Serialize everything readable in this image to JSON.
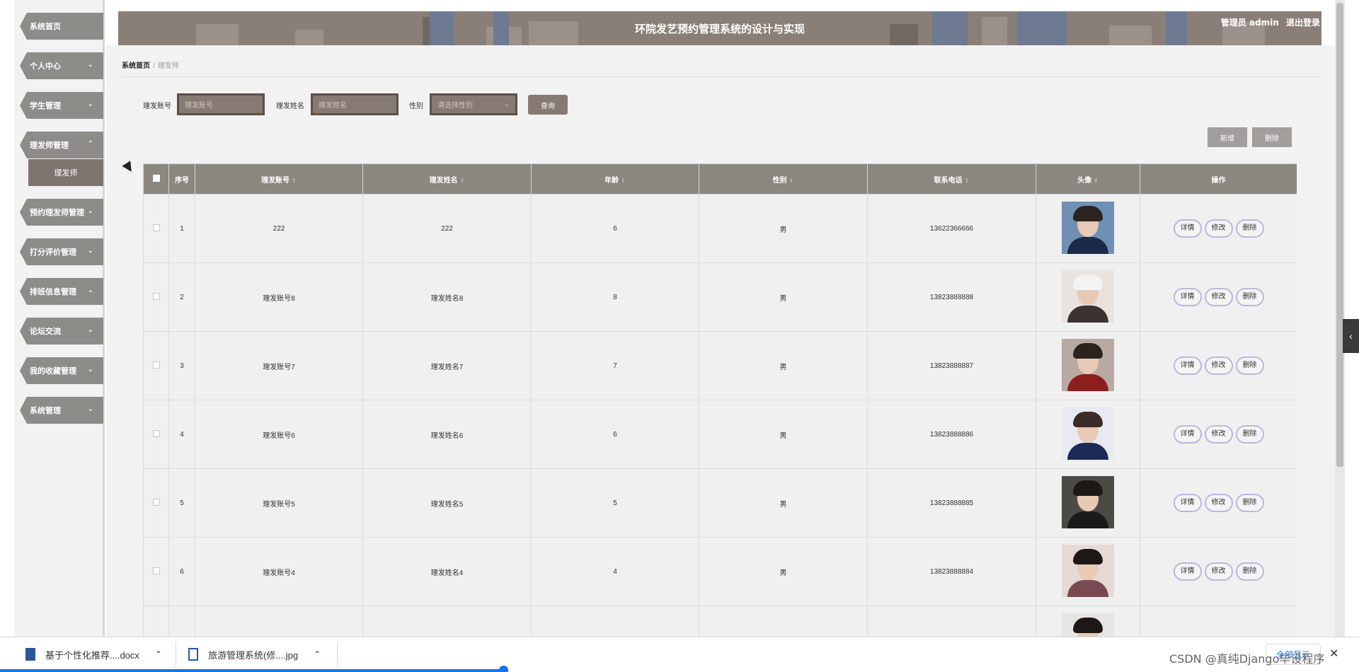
{
  "header": {
    "title": "环院发艺预约管理系统的设计与实现",
    "user_label": "管理员 admin",
    "logout_label": "退出登录"
  },
  "sidebar": {
    "items": [
      {
        "label": "系统首页",
        "has_chevron": false
      },
      {
        "label": "个人中心",
        "has_chevron": true,
        "chevron": "⌄"
      },
      {
        "label": "学生管理",
        "has_chevron": true,
        "chevron": "⌄"
      },
      {
        "label": "理发师管理",
        "has_chevron": true,
        "chevron": "⌃"
      },
      {
        "label": "预约理发师管理",
        "has_chevron": true,
        "chevron": "⌄"
      },
      {
        "label": "打分评价管理",
        "has_chevron": true,
        "chevron": "⌄"
      },
      {
        "label": "排班信息管理",
        "has_chevron": true,
        "chevron": "⌄"
      },
      {
        "label": "论坛交流",
        "has_chevron": true,
        "chevron": "⌄"
      },
      {
        "label": "我的收藏管理",
        "has_chevron": true,
        "chevron": "⌄"
      },
      {
        "label": "系统管理",
        "has_chevron": true,
        "chevron": "⌄"
      }
    ],
    "sub_item": "理发师"
  },
  "breadcrumb": {
    "home": "系统首页",
    "separator": "/",
    "current": "理发师"
  },
  "search": {
    "account_label": "理发账号",
    "account_placeholder": "理发账号",
    "name_label": "理发姓名",
    "name_placeholder": "理发姓名",
    "gender_label": "性别",
    "gender_placeholder": "请选择性别",
    "query_button": "查询"
  },
  "actions": {
    "add_button": "新增",
    "delete_button": "删除"
  },
  "table": {
    "columns": [
      "序号",
      "理发账号",
      "理发姓名",
      "年龄",
      "性别",
      "联系电话",
      "头像",
      "操作"
    ],
    "row_buttons": [
      "详情",
      "修改",
      "删除"
    ],
    "rows": [
      {
        "index": "1",
        "account": "222",
        "name": "222",
        "age": "6",
        "gender": "男",
        "phone": "13622366666"
      },
      {
        "index": "2",
        "account": "理发账号8",
        "name": "理发姓名8",
        "age": "8",
        "gender": "男",
        "phone": "13823888888"
      },
      {
        "index": "3",
        "account": "理发账号7",
        "name": "理发姓名7",
        "age": "7",
        "gender": "男",
        "phone": "13823888887"
      },
      {
        "index": "4",
        "account": "理发账号6",
        "name": "理发姓名6",
        "age": "6",
        "gender": "男",
        "phone": "13823888886"
      },
      {
        "index": "5",
        "account": "理发账号5",
        "name": "理发姓名5",
        "age": "5",
        "gender": "男",
        "phone": "13823888885"
      },
      {
        "index": "6",
        "account": "理发账号4",
        "name": "理发姓名4",
        "age": "4",
        "gender": "男",
        "phone": "13823888884"
      },
      {
        "index": "",
        "account": "",
        "name": "",
        "age": "",
        "gender": "",
        "phone": ""
      }
    ]
  },
  "downloads": {
    "items": [
      {
        "name": "基于个性化推荐....docx",
        "icon": "word-doc-icon"
      },
      {
        "name": "旅游管理系统(修....jpg",
        "icon": "image-file-icon"
      }
    ],
    "show_all": "全部显示",
    "watermark": "CSDN @真纯Django毕设程序"
  },
  "colors": {
    "accent": "#867a73",
    "header_bg": "#8a7f78",
    "table_head": "#8c8681",
    "op_button_border": "#b9b8e0"
  }
}
